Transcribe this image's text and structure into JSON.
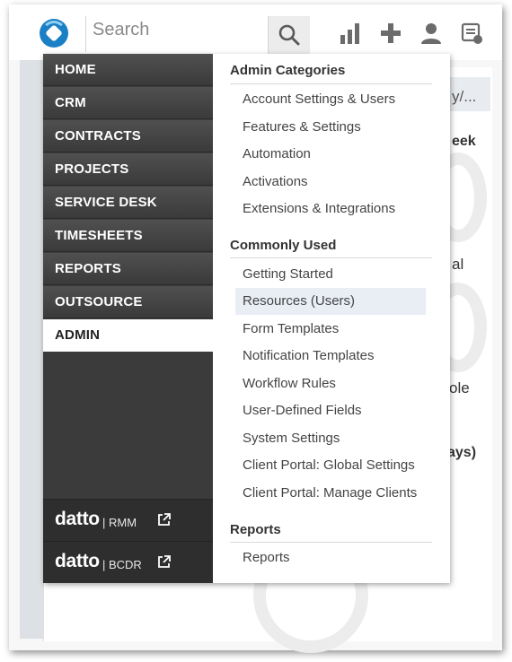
{
  "topbar": {
    "search_placeholder": "Search",
    "icons": [
      "app-logo-icon",
      "search-icon",
      "bar-chart-icon",
      "plus-icon",
      "user-icon",
      "inbox-icon"
    ]
  },
  "nav": {
    "items": [
      "HOME",
      "CRM",
      "CONTRACTS",
      "PROJECTS",
      "SERVICE DESK",
      "TIMESHEETS",
      "REPORTS",
      "OUTSOURCE",
      "ADMIN"
    ],
    "active": "ADMIN",
    "external": [
      {
        "brand": "datto",
        "product": "| RMM"
      },
      {
        "brand": "datto",
        "product": "| BCDR"
      }
    ]
  },
  "sections": [
    {
      "title": "Admin Categories",
      "links": [
        "Account Settings & Users",
        "Features & Settings",
        "Automation",
        "Activations",
        "Extensions & Integrations"
      ]
    },
    {
      "title": "Commonly Used",
      "links": [
        "Getting Started",
        "Resources (Users)",
        "Form Templates",
        "Notification Templates",
        "Workflow Rules",
        "User-Defined Fields",
        "System Settings",
        "Client Portal: Global Settings",
        "Client Portal: Manage Clients"
      ]
    },
    {
      "title": "Reports",
      "links": [
        "Reports"
      ]
    }
  ],
  "highlighted_link": "Resources (Users)",
  "background": {
    "fragments": [
      "y/...",
      "eek",
      "al",
      "ole",
      "ays)"
    ]
  },
  "colors": {
    "nav_bg": "#3d3d3d",
    "active_bg": "#ffffff",
    "highlight": "#e9eef5",
    "logo": "#1a7fc4"
  }
}
